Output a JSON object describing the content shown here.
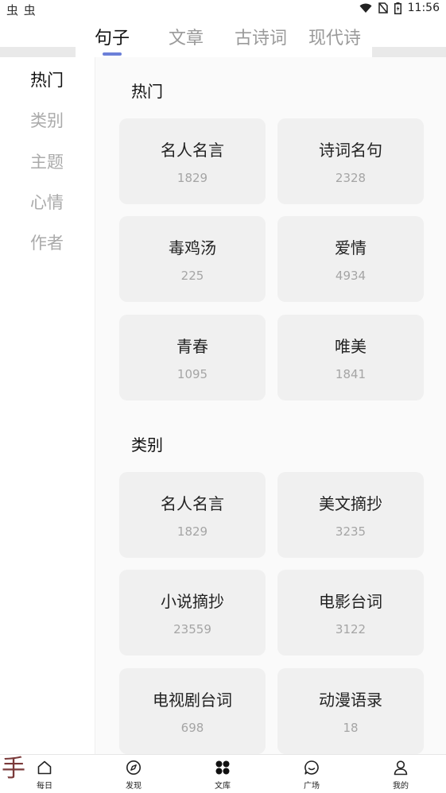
{
  "status_bar": {
    "left_icons": "虫 虫",
    "time": "11:56"
  },
  "top_tabs": [
    {
      "label": "句子",
      "active": true
    },
    {
      "label": "文章",
      "active": false
    },
    {
      "label": "古诗词",
      "active": false
    },
    {
      "label": "现代诗",
      "active": false
    }
  ],
  "sidebar": {
    "items": [
      {
        "label": "热门",
        "active": true
      },
      {
        "label": "类别",
        "active": false
      },
      {
        "label": "主题",
        "active": false
      },
      {
        "label": "心情",
        "active": false
      },
      {
        "label": "作者",
        "active": false
      }
    ]
  },
  "sections": [
    {
      "title": "热门",
      "cards": [
        {
          "title": "名人名言",
          "count": "1829"
        },
        {
          "title": "诗词名句",
          "count": "2328"
        },
        {
          "title": "毒鸡汤",
          "count": "225"
        },
        {
          "title": "爱情",
          "count": "4934"
        },
        {
          "title": "青春",
          "count": "1095"
        },
        {
          "title": "唯美",
          "count": "1841"
        }
      ]
    },
    {
      "title": "类别",
      "cards": [
        {
          "title": "名人名言",
          "count": "1829"
        },
        {
          "title": "美文摘抄",
          "count": "3235"
        },
        {
          "title": "小说摘抄",
          "count": "23559"
        },
        {
          "title": "电影台词",
          "count": "3122"
        },
        {
          "title": "电视剧台词",
          "count": "698"
        },
        {
          "title": "动漫语录",
          "count": "18"
        }
      ]
    }
  ],
  "overlay_text": "手",
  "bottom_nav": [
    {
      "label": "每日",
      "icon": "home-icon"
    },
    {
      "label": "发现",
      "icon": "compass-icon"
    },
    {
      "label": "文库",
      "icon": "grid-icon"
    },
    {
      "label": "广场",
      "icon": "chat-icon"
    },
    {
      "label": "我的",
      "icon": "user-icon"
    }
  ],
  "colors": {
    "accent": "#6b7fd8",
    "card_bg": "#f0f0f0",
    "inactive_text": "#aaaaaa"
  }
}
